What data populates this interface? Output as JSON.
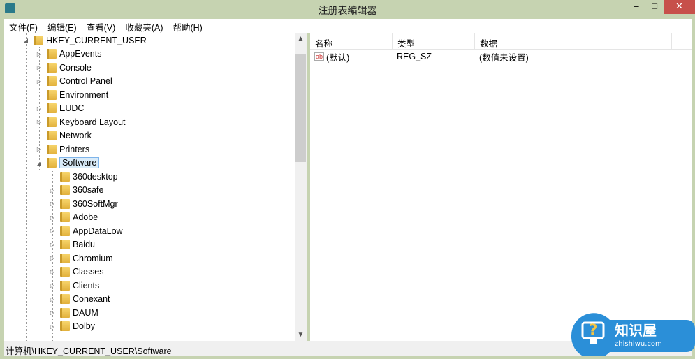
{
  "window": {
    "title": "注册表编辑器",
    "minimize": "–",
    "maximize": "□",
    "close": "✕"
  },
  "menu": [
    "文件(F)",
    "编辑(E)",
    "查看(V)",
    "收藏夹(A)",
    "帮助(H)"
  ],
  "tree": {
    "root": "HKEY_CURRENT_USER",
    "children": [
      {
        "label": "AppEvents",
        "expandable": true
      },
      {
        "label": "Console",
        "expandable": true
      },
      {
        "label": "Control Panel",
        "expandable": true
      },
      {
        "label": "Environment",
        "expandable": false
      },
      {
        "label": "EUDC",
        "expandable": true
      },
      {
        "label": "Keyboard Layout",
        "expandable": true
      },
      {
        "label": "Network",
        "expandable": false
      },
      {
        "label": "Printers",
        "expandable": true
      },
      {
        "label": "Software",
        "expandable": true,
        "expanded": true,
        "selected": true
      }
    ],
    "software_children": [
      {
        "label": "360desktop",
        "expandable": false
      },
      {
        "label": "360safe",
        "expandable": true
      },
      {
        "label": "360SoftMgr",
        "expandable": true
      },
      {
        "label": "Adobe",
        "expandable": true
      },
      {
        "label": "AppDataLow",
        "expandable": true
      },
      {
        "label": "Baidu",
        "expandable": true
      },
      {
        "label": "Chromium",
        "expandable": true
      },
      {
        "label": "Classes",
        "expandable": true
      },
      {
        "label": "Clients",
        "expandable": true
      },
      {
        "label": "Conexant",
        "expandable": true
      },
      {
        "label": "DAUM",
        "expandable": true
      },
      {
        "label": "Dolby",
        "expandable": true
      }
    ]
  },
  "values": {
    "columns": [
      "名称",
      "类型",
      "数据"
    ],
    "rows": [
      {
        "name": "(默认)",
        "type": "REG_SZ",
        "data": "(数值未设置)",
        "icon": "string-value-icon"
      }
    ]
  },
  "status": "计算机\\HKEY_CURRENT_USER\\Software",
  "watermark": {
    "title": "知识屋",
    "url": "zhishiwu.com"
  }
}
